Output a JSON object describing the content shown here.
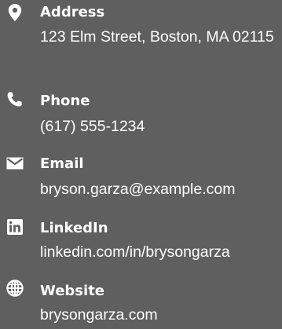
{
  "contacts": [
    {
      "icon": "map-marker-icon",
      "title": "Address",
      "value": "123 Elm Street, Boston, MA 02115"
    },
    {
      "icon": "phone-icon",
      "title": "Phone",
      "value": "(617) 555-1234"
    },
    {
      "icon": "envelope-icon",
      "title": "Email",
      "value": "bryson.garza@example.com"
    },
    {
      "icon": "linkedin-icon",
      "title": "LinkedIn",
      "value": "linkedin.com/in/brysongarza"
    },
    {
      "icon": "globe-icon",
      "title": "Website",
      "value": "brysongarza.com"
    }
  ]
}
